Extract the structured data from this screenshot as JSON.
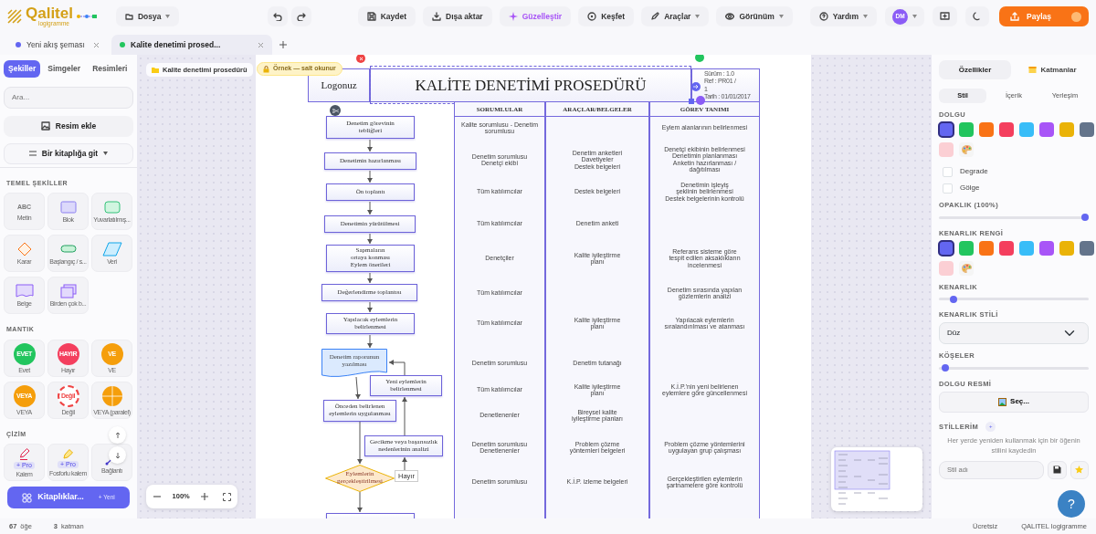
{
  "app": {
    "logo": "Qalitel",
    "logo_sub": "logigramme"
  },
  "toolbar": {
    "file_menu": "Dosya",
    "buttons": [
      {
        "label": "Kaydet",
        "kind": "save"
      },
      {
        "label": "Dışa aktar",
        "kind": "export"
      },
      {
        "label": "Güzelleştir",
        "kind": "beautify"
      },
      {
        "label": "Keşfet",
        "kind": "explore"
      }
    ],
    "menus": [
      {
        "label": "Araçlar",
        "kind": "tools"
      },
      {
        "label": "Görünüm",
        "kind": "view"
      }
    ],
    "help_menu": "Yardım",
    "avatar": "DM",
    "share": "Paylaş"
  },
  "tabs": [
    {
      "label": "Yeni akış şeması",
      "selected": false,
      "color": "#6366f1"
    },
    {
      "label": "Kalite denetimi prosed...",
      "selected": true,
      "color": "#22c55e"
    }
  ],
  "left_panel": {
    "tabs": [
      {
        "label": "Şekiller",
        "selected": true
      },
      {
        "label": "Simgeler",
        "selected": false
      },
      {
        "label": "Resimleri",
        "selected": false
      }
    ],
    "search": {
      "placeholder": "Ara..."
    },
    "add_image": "Resim ekle",
    "library_picker": "Bir kitaplığa git",
    "sections": [
      {
        "title": "TEMEL ŞEKİLLER",
        "items": [
          {
            "label": "Metin",
            "kind": "text",
            "glyph": "ABC"
          },
          {
            "label": "Blok",
            "kind": "rect"
          },
          {
            "label": "Yuvarlatılmış...",
            "kind": "rounded"
          },
          {
            "label": "Karar",
            "kind": "diamond"
          },
          {
            "label": "Başlangıç / s...",
            "kind": "pill"
          },
          {
            "label": "Veri",
            "kind": "parallelogram"
          },
          {
            "label": "Belge",
            "kind": "document"
          },
          {
            "label": "Birden çok b...",
            "kind": "multidoc"
          }
        ]
      },
      {
        "title": "MANTIK",
        "items": [
          {
            "label": "Evet",
            "kind": "circle",
            "glyph": "EVET",
            "color": "#22c55e"
          },
          {
            "label": "Hayır",
            "kind": "circle",
            "glyph": "HAYIR",
            "color": "#f43f5e"
          },
          {
            "label": "VE",
            "kind": "circle",
            "glyph": "VE",
            "color": "#f59e0b"
          },
          {
            "label": "VEYA",
            "kind": "circle",
            "glyph": "VEYA",
            "color": "#f59e0b"
          },
          {
            "label": "Değil",
            "kind": "dashed",
            "glyph": "Değil",
            "color": "#ef4444"
          },
          {
            "label": "VEYA (paralel)",
            "kind": "split",
            "color": "#f59e0b"
          }
        ]
      },
      {
        "title": "ÇİZİM",
        "items": [
          {
            "label": "Kalem",
            "kind": "pen",
            "pro": "+ Pro"
          },
          {
            "label": "Fosforlu kalem",
            "kind": "highlighter",
            "pro": "+ Pro"
          },
          {
            "label": "Bağlantı",
            "kind": "connector"
          }
        ]
      }
    ],
    "libraries_button": "Kitaplıklar...",
    "libraries_hint": "+ Yeni"
  },
  "canvas": {
    "document_chip": "Kalite denetimi prosedürü",
    "readonly_chip": "Örnek — salt okunur",
    "zoom": "100%",
    "diagram": {
      "logo_text": "Logonuz",
      "title": "KALİTE DENETİMİ PROSEDÜRÜ",
      "info_lines": [
        "Sürüm : 1.0",
        "Ref : PR01 /",
        "1",
        "Tarih : 01/01/2017"
      ],
      "steps": [
        {
          "text": "Denetim görevinin\ntebliğleri",
          "kind": "process"
        },
        {
          "text": "Denetimin hazırlanması",
          "kind": "process"
        },
        {
          "text": "Ön toplantı",
          "kind": "process"
        },
        {
          "text": "Denetimin yürütülmesi",
          "kind": "process"
        },
        {
          "text": "Sapmaların\nortaya konması\nEylem önerileri",
          "kind": "process"
        },
        {
          "text": "Değerlendirme toplantısı",
          "kind": "process"
        },
        {
          "text": "Yapılacak eylemlerin\nbelirlenmesi",
          "kind": "process"
        },
        {
          "text": "Denetim raporunun\nyazılması",
          "kind": "document"
        },
        {
          "text": "Yeni eylemlerin\nbelirlenmesi",
          "kind": "process"
        },
        {
          "text": "Önceden belirlenen\neylemlerin uygulanması",
          "kind": "process"
        },
        {
          "text": "Gecikme veya başarısızlık\nnedenlerinin analizi",
          "kind": "process"
        },
        {
          "text": "Eylemlerin\ngerçekleştirilmesi",
          "kind": "decision"
        }
      ],
      "edge_labels": [
        "Hayır"
      ],
      "table": {
        "columns": [
          "SORUMLULAR",
          "ARAÇLAR/BELGELER",
          "GÖREV TANIMI"
        ],
        "rows": [
          {
            "responsible": "Kalite sorumlusu - Denetim sorumlusu",
            "task": "Eylem alanlarının belirlenmesi"
          },
          {
            "responsible": "Denetim sorumlusu\nDenetçi ekibi",
            "tools": "Denetim anketleri\nDavetiyeler\nDestek belgeleri",
            "task": "Denetçi ekibinin belirlenmesi\nDenetimin planlanması\nAnketin hazırlanması /\ndağıtılması"
          },
          {
            "responsible": "Tüm katılımcılar",
            "tools": "Destek belgeleri",
            "task": "Denetimin işleyiş\nşeklinin belirlenmesi\nDestek belgelerinin kontrolü"
          },
          {
            "responsible": "Tüm katılımcılar",
            "tools": "Denetim anketi"
          },
          {
            "responsible": "Denetçiler",
            "tools": "Kalite iyileştirme\nplanı",
            "task": "Referans sisteme göre\ntespit edilen aksaklıkların\nincelenmesi"
          },
          {
            "responsible": "Tüm katılımcılar",
            "task": "Denetim sırasında yapılan\ngözlemlerin analizi"
          },
          {
            "responsible": "Tüm katılımcılar",
            "tools": "Kalite iyileştirme\nplanı",
            "task": "Yapılacak eylemlerin\nsıralandırılması ve atanması"
          },
          {
            "responsible": "Denetim sorumlusu",
            "tools": "Denetim tutanağı"
          },
          {
            "responsible": "Tüm katılımcılar",
            "tools": "Kalite iyileştirme\nplanı",
            "task": "K.İ.P.'nin yeni belirlenen\neylemlere göre güncellenmesi"
          },
          {
            "responsible": "Denetlenenler",
            "tools": "Bireysel kalite\niyileştirme planları"
          },
          {
            "responsible": "Denetim sorumlusu\nDenetlenenler",
            "tools": "Problem çözme\nyöntemleri belgeleri",
            "task": "Problem çözme yöntemlerini\nuygulayan grup çalışması"
          },
          {
            "responsible": "Denetim sorumlusu",
            "tools": "K.İ.P. izleme belgeleri",
            "task": "Gerçekleştirilen eylemlerin\nşartnamelere göre kontrolü"
          }
        ]
      }
    }
  },
  "properties": {
    "tabs": [
      {
        "label": "Özellikler",
        "selected": true
      },
      {
        "label": "Katmanlar",
        "selected": false
      }
    ],
    "subtabs": [
      {
        "label": "Stil",
        "selected": true
      },
      {
        "label": "İçerik",
        "selected": false
      },
      {
        "label": "Yerleşim",
        "selected": false
      }
    ],
    "fill": {
      "title": "DOLGU",
      "swatches": [
        {
          "color": "#6366f1",
          "selected": true
        },
        {
          "color": "#22c55e",
          "selected": false
        },
        {
          "color": "#f97316",
          "selected": false
        },
        {
          "color": "#f43f5e",
          "selected": false
        },
        {
          "color": "#38bdf8",
          "selected": false
        },
        {
          "color": "#a855f7",
          "selected": false
        },
        {
          "color": "#eab308",
          "selected": false
        },
        {
          "color": "#64748b",
          "selected": false
        },
        {
          "color": "#fbcfd4",
          "selected": false
        }
      ]
    },
    "options": [
      {
        "label": "Degrade",
        "checked": false
      },
      {
        "label": "Gölge",
        "checked": false
      }
    ],
    "opacity": {
      "title": "OPAKLIK (100%)",
      "level": 1
    },
    "border_color": {
      "title": "KENARLIK RENGİ",
      "swatches": [
        {
          "color": "#6366f1",
          "selected": true
        },
        {
          "color": "#22c55e",
          "selected": false
        },
        {
          "color": "#f97316",
          "selected": false
        },
        {
          "color": "#f43f5e",
          "selected": false
        },
        {
          "color": "#38bdf8",
          "selected": false
        },
        {
          "color": "#a855f7",
          "selected": false
        },
        {
          "color": "#eab308",
          "selected": false
        },
        {
          "color": "#64748b",
          "selected": false
        },
        {
          "color": "#fbcfd4",
          "selected": false
        }
      ]
    },
    "border": {
      "title": "KENARLIK",
      "level": 0.08
    },
    "border_style": {
      "title": "KENARLIK STİLİ",
      "value": "Düz"
    },
    "corners": {
      "title": "KÖŞELER",
      "level": 0.02
    },
    "fill_image": {
      "title": "DOLGU RESMİ",
      "button": "Seç..."
    },
    "my_styles": {
      "title": "STİLLERİM",
      "badge": "+",
      "hint": "Her yerde yeniden kullanmak için bir öğenin stilini kaydedin",
      "name_field": {
        "placeholder": "Stil adı"
      }
    },
    "help_button": "?"
  },
  "status_bar": {
    "items_count": "67",
    "items_label": "öğe",
    "layers_count": "3",
    "layers_label": "katman",
    "plan": "Ücretsiz",
    "brand": "QALITEL logigramme"
  }
}
